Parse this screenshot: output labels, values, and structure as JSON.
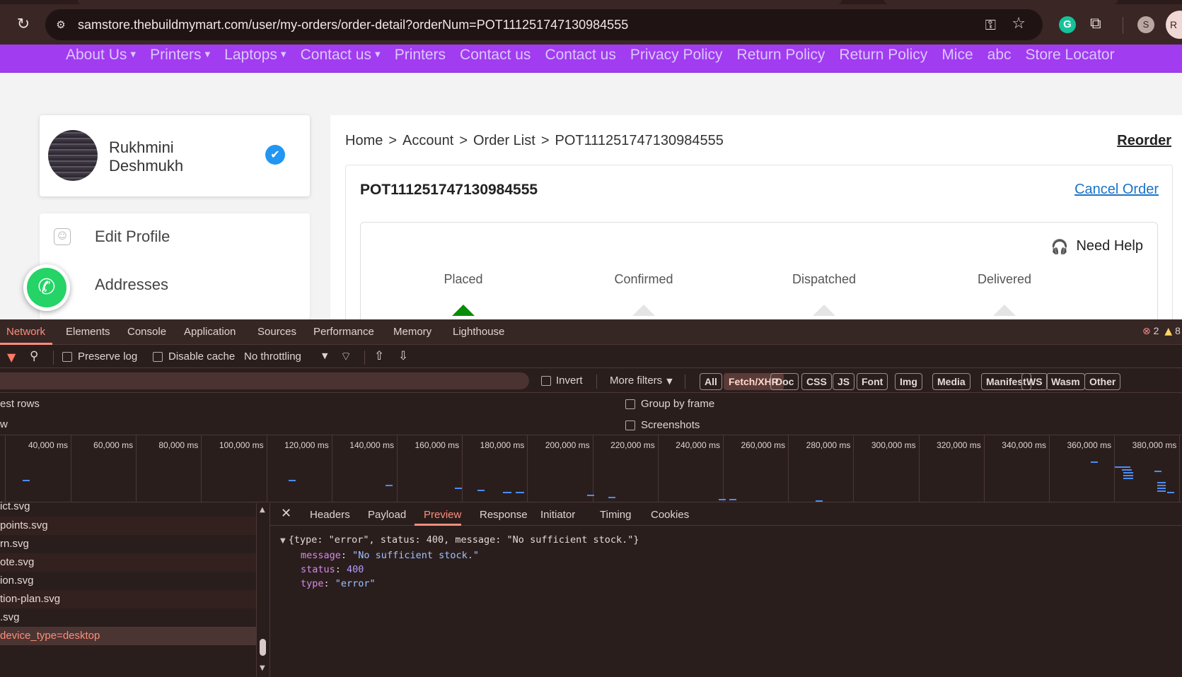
{
  "browser": {
    "url": "samstore.thebuildmymart.com/user/my-orders/order-detail?orderNum=POT111251747130984555",
    "profile_initial": "S",
    "profile2_initial": "R"
  },
  "site_nav": {
    "items": [
      {
        "label": "About Us",
        "dropdown": true
      },
      {
        "label": "Printers",
        "dropdown": true
      },
      {
        "label": "Laptops",
        "dropdown": true
      },
      {
        "label": "Contact us",
        "dropdown": true
      },
      {
        "label": "Printers",
        "dropdown": false
      },
      {
        "label": "Contact us",
        "dropdown": false
      },
      {
        "label": "Contact us",
        "dropdown": false
      },
      {
        "label": "Privacy Policy",
        "dropdown": false
      },
      {
        "label": "Return Policy",
        "dropdown": false
      },
      {
        "label": "Return Policy",
        "dropdown": false
      },
      {
        "label": "Mice",
        "dropdown": false
      },
      {
        "label": "abc",
        "dropdown": false
      },
      {
        "label": "Store Locator",
        "dropdown": false
      }
    ],
    "caret": "▼"
  },
  "profile": {
    "name": "Rukhmini Deshmukh",
    "verified_glyph": "✔"
  },
  "account_menu": {
    "items": [
      {
        "label": "Edit Profile",
        "icon": "user-icon"
      },
      {
        "label": "Addresses",
        "icon": "location-icon"
      }
    ]
  },
  "order": {
    "breadcrumb": [
      "Home",
      "Account",
      "Order List",
      "POT111251747130984555"
    ],
    "breadcrumb_sep": ">",
    "reorder_label": "Reorder",
    "order_number": "POT111251747130984555",
    "cancel_label": "Cancel Order",
    "need_help_label": "Need Help",
    "steps": [
      "Placed",
      "Confirmed",
      "Dispatched",
      "Delivered"
    ],
    "active_step": 0,
    "colors": {
      "active_step": "#0a8c0a",
      "link": "#1a73c8"
    }
  },
  "devtools": {
    "tabs": [
      "Network",
      "Elements",
      "Console",
      "Application",
      "Sources",
      "Performance",
      "Memory",
      "Lighthouse"
    ],
    "active_tab": "Network",
    "issues": {
      "errors": "2",
      "warnings": "8"
    },
    "toolbar": {
      "preserve_log": "Preserve log",
      "disable_cache": "Disable cache",
      "throttling": "No throttling"
    },
    "filter": {
      "invert": "Invert",
      "more_filters": "More filters",
      "types": [
        "All",
        "Fetch/XHR",
        "Doc",
        "CSS",
        "JS",
        "Font",
        "Img",
        "Media",
        "Manifest",
        "WS",
        "Wasm",
        "Other"
      ],
      "active_type": "Fetch/XHR"
    },
    "options": {
      "left1": "est rows",
      "left2": "w",
      "group_by_frame": "Group by frame",
      "screenshots": "Screenshots"
    },
    "timeline_ticks": [
      "40,000 ms",
      "60,000 ms",
      "80,000 ms",
      "100,000 ms",
      "120,000 ms",
      "140,000 ms",
      "160,000 ms",
      "180,000 ms",
      "200,000 ms",
      "220,000 ms",
      "240,000 ms",
      "260,000 ms",
      "280,000 ms",
      "300,000 ms",
      "320,000 ms",
      "340,000 ms",
      "360,000 ms",
      "380,000 ms"
    ],
    "requests": [
      {
        "name": "ict.svg",
        "state": "normal"
      },
      {
        "name": "points.svg",
        "state": "normal"
      },
      {
        "name": "rn.svg",
        "state": "normal"
      },
      {
        "name": "ote.svg",
        "state": "normal"
      },
      {
        "name": "ion.svg",
        "state": "normal"
      },
      {
        "name": "tion-plan.svg",
        "state": "normal"
      },
      {
        "name": ".svg",
        "state": "normal"
      },
      {
        "name": "device_type=desktop",
        "state": "error"
      }
    ],
    "footer_text": "",
    "detail_tabs": [
      "Headers",
      "Payload",
      "Preview",
      "Response",
      "Initiator",
      "Timing",
      "Cookies"
    ],
    "active_detail_tab": "Preview",
    "preview": {
      "summary": "{type: \"error\", status: 400, message: \"No sufficient stock.\"}",
      "fields": [
        {
          "key": "message",
          "value": "\"No sufficient stock.\"",
          "kind": "str"
        },
        {
          "key": "status",
          "value": "400",
          "kind": "num"
        },
        {
          "key": "type",
          "value": "\"error\"",
          "kind": "str"
        }
      ]
    }
  }
}
